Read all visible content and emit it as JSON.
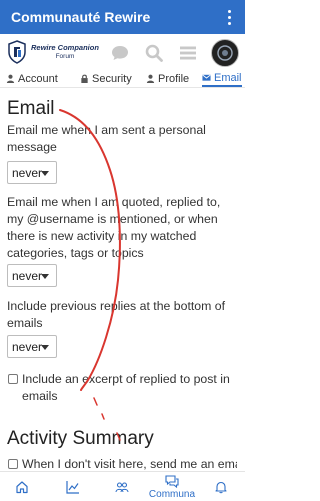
{
  "appbar": {
    "title": "Communauté Rewire"
  },
  "logo": {
    "line1": "Rewire Companion",
    "line2": "Forum"
  },
  "tabs": [
    {
      "label": "Account",
      "icon": "user-icon"
    },
    {
      "label": "Security",
      "icon": "lock-icon"
    },
    {
      "label": "Profile",
      "icon": "user-icon"
    },
    {
      "label": "Email",
      "icon": "envelope-icon",
      "active": true
    }
  ],
  "email": {
    "heading": "Email",
    "sent_label": "Email me when I am sent a personal message",
    "sent_value": "never",
    "quoted_label": "Email me when I am quoted, replied to, my @username is mentioned, or when there is new activity in my watched categories, tags or topics",
    "quoted_value": "never",
    "previous_label": "Include previous replies at the bottom of emails",
    "previous_value": "never",
    "excerpt_label": "Include an excerpt of replied to post in emails"
  },
  "activity": {
    "heading": "Activity Summary",
    "partial_label": "When I don't visit here, send me an email"
  },
  "bottom_nav": {
    "active_label": "Communa"
  },
  "colors": {
    "brand": "#2f6fc7",
    "annotation": "#d9362f"
  }
}
